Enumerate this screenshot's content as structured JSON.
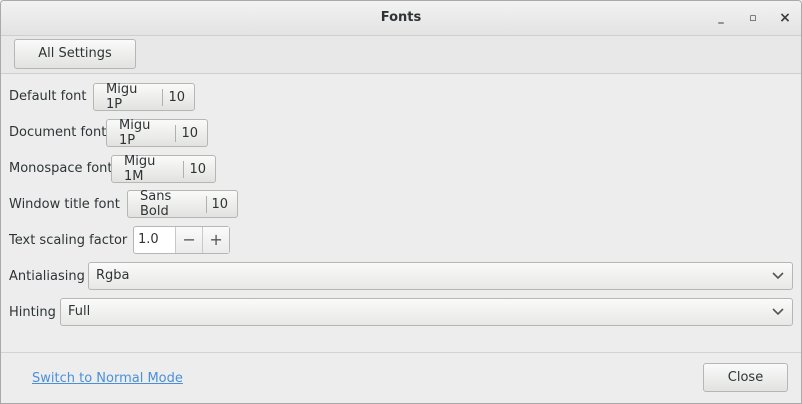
{
  "window": {
    "title": "Fonts",
    "controls": {
      "minimize": "_",
      "maximize": "▫",
      "close": "×"
    }
  },
  "toolbar": {
    "all_settings_label": "All Settings"
  },
  "settings": {
    "default_font": {
      "label": "Default font",
      "font": "Migu 1P",
      "size": "10"
    },
    "document_font": {
      "label": "Document font",
      "font": "Migu 1P",
      "size": "10"
    },
    "monospace_font": {
      "label": "Monospace font",
      "font": "Migu 1M",
      "size": "10"
    },
    "window_title_font": {
      "label": "Window title font",
      "font": "Sans Bold",
      "size": "10"
    },
    "text_scaling": {
      "label": "Text scaling factor",
      "value": "1.0",
      "decrement": "−",
      "increment": "+"
    },
    "antialiasing": {
      "label": "Antialiasing",
      "value": "Rgba"
    },
    "hinting": {
      "label": "Hinting",
      "value": "Full"
    }
  },
  "footer": {
    "mode_link": "Switch to Normal Mode",
    "close_label": "Close"
  },
  "icons": {
    "dropdown": "chevron-down-icon"
  },
  "colors": {
    "link": "#4a90d9"
  }
}
